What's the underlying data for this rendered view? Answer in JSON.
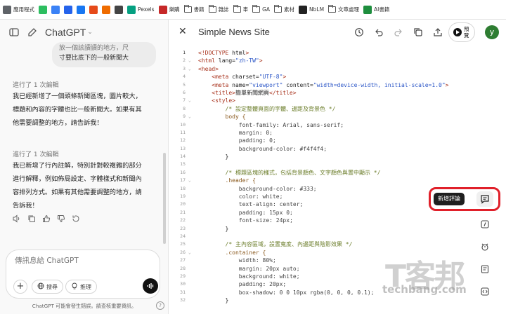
{
  "bookmarks": [
    {
      "label": "應用程式",
      "icon": "apps-grid-icon",
      "color": "#5f6368"
    },
    {
      "label": "",
      "icon": "evernote-icon",
      "color": "#2dbe60"
    },
    {
      "label": "",
      "icon": "square-logo-icon",
      "color": "#3b82f6"
    },
    {
      "label": "",
      "icon": "g-logo-icon",
      "color": "#2563eb"
    },
    {
      "label": "",
      "icon": "meta-logo-icon",
      "color": "#1877f2"
    },
    {
      "label": "",
      "icon": "trend-icon",
      "color": "#e64a19"
    },
    {
      "label": "",
      "icon": "flame-icon",
      "color": "#ef6c00"
    },
    {
      "label": "",
      "icon": "n-logo-icon",
      "color": "#444444"
    },
    {
      "label": "Pexels",
      "icon": "pexels-icon",
      "color": "#05a081"
    },
    {
      "label": "樂購",
      "icon": "shop-icon",
      "color": "#c62828"
    },
    {
      "label": "書籍",
      "icon": "folder-icon",
      "color": "#555555"
    },
    {
      "label": "雜誌",
      "icon": "folder-icon",
      "color": "#555555"
    },
    {
      "label": "車",
      "icon": "folder-icon",
      "color": "#555555"
    },
    {
      "label": "GA",
      "icon": "folder-icon",
      "color": "#555555"
    },
    {
      "label": "素材",
      "icon": "folder-icon",
      "color": "#555555"
    },
    {
      "label": "NbLM",
      "icon": "notebooklm-icon",
      "color": "#222222"
    },
    {
      "label": "文章處理",
      "icon": "folder-icon",
      "color": "#555555"
    },
    {
      "label": "AI書籍",
      "icon": "ai-sheet-icon",
      "color": "#1e8e3e"
    }
  ],
  "chat": {
    "model_name": "ChatGPT",
    "bubble_line1": "放一個該讀讀的地方，尺",
    "bubble_line2": "寸要比底下的一般新聞大",
    "edits": [
      {
        "meta": "進行了 1 次編輯",
        "lines": [
          "我已經新增了一個頭條新聞區塊，圖片較大，",
          "標題和內容的字體也比一般新聞大。如果有其",
          "他需要調整的地方，請告訴我！"
        ]
      },
      {
        "meta": "進行了 1 次編輯",
        "lines": [
          "我已新增了行內註解，特別針對較複雜的部分",
          "進行解釋，例如佈局設定、字體樣式和新聞內",
          "容排列方式。如果有其他需要調整的地方，請",
          "告訴我！"
        ]
      }
    ],
    "composer_placeholder": "傳訊息給 ChatGPT",
    "search_label": "搜尋",
    "reason_label": "推理",
    "disclaimer": "ChatGPT 可能會發生錯誤。請查核重要資訊。",
    "help": "?"
  },
  "canvas": {
    "title": "Simple News Site",
    "preview_label": "預覽",
    "avatar_initial": "y",
    "tooltip": "新增評論",
    "code_lines": [
      "<!DOCTYPE html>",
      "<html lang=\"zh-TW\">",
      "<head>",
      "    <meta charset=\"UTF-8\">",
      "    <meta name=\"viewport\" content=\"width=device-width, initial-scale=1.0\">",
      "    <title>簡單新聞網頁</title>",
      "    <style>",
      "        /* 設定整體頁面的字體、邊距及背景色 */",
      "        body {",
      "            font-family: Arial, sans-serif;",
      "            margin: 0;",
      "            padding: 0;",
      "            background-color: #f4f4f4;",
      "        }",
      "",
      "        /* 標題區塊的樣式，包括背景顏色、文字顏色與置中顯示 */",
      "        .header {",
      "            background-color: #333;",
      "            color: white;",
      "            text-align: center;",
      "            padding: 15px 0;",
      "            font-size: 24px;",
      "        }",
      "",
      "        /* 主內容區域，設置寬度、內邊距與陰影效果 */",
      "        .container {",
      "            width: 80%;",
      "            margin: 20px auto;",
      "            background: white;",
      "            padding: 20px;",
      "            box-shadow: 0 0 10px rgba(0, 0, 0, 0.1);",
      "        }"
    ]
  },
  "watermark": {
    "big": "T客邦",
    "small": "techbang.com"
  },
  "colors": {
    "highlight_border": "#e0202a",
    "avatar_bg": "#2e7d32"
  }
}
